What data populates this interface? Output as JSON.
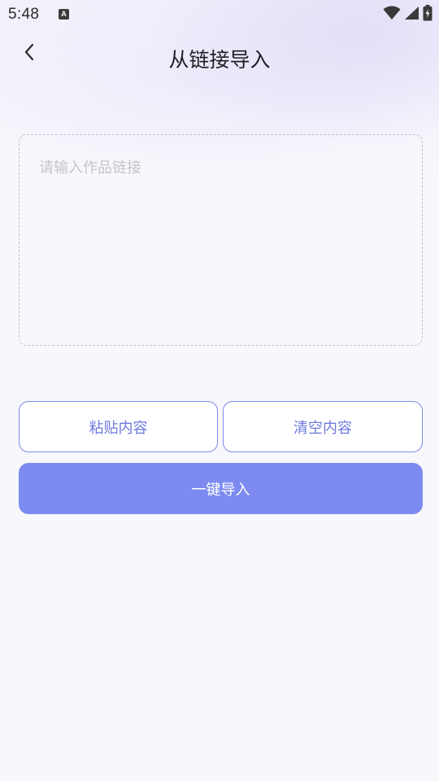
{
  "status_bar": {
    "time": "5:48",
    "notification_icon_letter": "A",
    "icons": [
      "wifi-icon",
      "signal-icon",
      "battery-icon"
    ]
  },
  "header": {
    "back_icon": "chevron-left-icon",
    "title": "从链接导入"
  },
  "link_input": {
    "value": "",
    "placeholder": "请输入作品链接"
  },
  "actions": {
    "paste_label": "粘贴内容",
    "clear_label": "清空内容",
    "import_label": "一键导入"
  },
  "colors": {
    "accent": "#7d8bf0",
    "outline_text": "#6e79de",
    "outline_border": "#7f89e6",
    "background": "#f7f7fc"
  }
}
